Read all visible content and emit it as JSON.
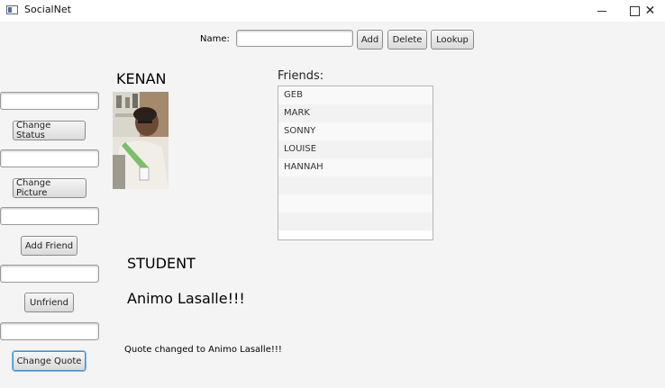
{
  "window": {
    "title": "SocialNet",
    "close_glyph": "✕"
  },
  "top_bar": {
    "name_label": "Name:",
    "name_value": "",
    "add_label": "Add",
    "delete_label": "Delete",
    "lookup_label": "Lookup"
  },
  "left_panel": {
    "status_input": "",
    "change_status_label": "Change Status",
    "picture_input": "",
    "change_picture_label": "Change Picture",
    "friend_input": "",
    "add_friend_label": "Add Friend",
    "unfriend_input": "",
    "unfriend_label": "Unfriend",
    "quote_input": "",
    "change_quote_label": "Change Quote"
  },
  "profile": {
    "name": "KENAN",
    "status": "STUDENT",
    "quote": "Animo Lasalle!!!",
    "message": "Quote changed to Animo Lasalle!!!"
  },
  "friends": {
    "heading": "Friends:",
    "items": [
      "GEB",
      "MARK",
      "SONNY",
      "LOUISE",
      "HANNAH",
      "",
      "",
      "",
      ""
    ]
  },
  "colors": {
    "background": "#f4f4f4",
    "focus_accent": "#3d8fd6"
  }
}
